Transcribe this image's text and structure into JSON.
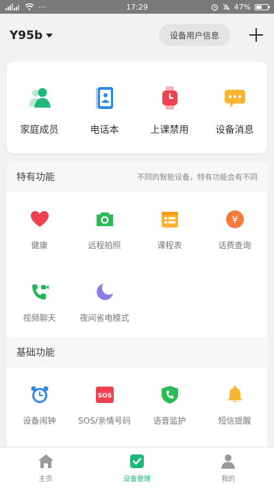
{
  "status_bar": {
    "time": "17:29",
    "battery": "47%",
    "battery_level": 0.47,
    "dots": "···"
  },
  "header": {
    "device_name": "Y95b",
    "info_button": "设备用户信息"
  },
  "top_actions": [
    {
      "label": "家庭成员",
      "icon": "family-members-icon"
    },
    {
      "label": "电话本",
      "icon": "phonebook-icon"
    },
    {
      "label": "上课禁用",
      "icon": "class-disable-watch-icon"
    },
    {
      "label": "设备消息",
      "icon": "device-message-icon"
    }
  ],
  "special": {
    "title": "特有功能",
    "subtitle": "不同的智能设备，特有功能会有不同",
    "items": [
      {
        "label": "健康",
        "icon": "heart-icon",
        "color": "#ef4050"
      },
      {
        "label": "远程拍照",
        "icon": "camera-icon",
        "color": "#2dbb55"
      },
      {
        "label": "课程表",
        "icon": "schedule-icon",
        "color": "#f7b531"
      },
      {
        "label": "话费查询",
        "icon": "yen-icon",
        "color": "#f5793a"
      },
      {
        "label": "视频聊天",
        "icon": "video-call-icon",
        "color": "#26b35a"
      },
      {
        "label": "夜间省电模式",
        "icon": "moon-icon",
        "color": "#8a7be8"
      }
    ]
  },
  "basic": {
    "title": "基础功能",
    "items": [
      {
        "label": "设备闹钟",
        "icon": "alarm-clock-icon",
        "color": "#2f8ae6"
      },
      {
        "label": "SOS/亲情号码",
        "icon": "sos-icon",
        "color": "#ef4050"
      },
      {
        "label": "语音监护",
        "icon": "voice-monitor-icon",
        "color": "#2dbb55"
      },
      {
        "label": "短信提醒",
        "icon": "bell-icon",
        "color": "#f7b531"
      }
    ]
  },
  "tabs": [
    {
      "label": "主页",
      "icon": "home-icon"
    },
    {
      "label": "设备管理",
      "icon": "device-manage-icon",
      "active": true
    },
    {
      "label": "我的",
      "icon": "profile-icon"
    }
  ],
  "colors": {
    "accent": "#1fb87a"
  }
}
